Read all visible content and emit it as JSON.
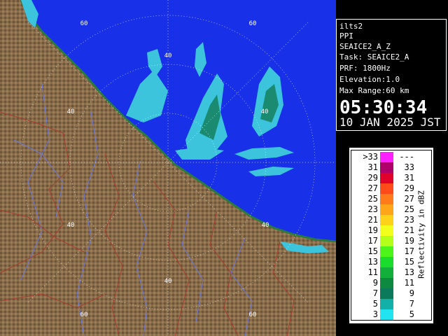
{
  "info": {
    "site": "ilts2",
    "product": "PPI",
    "scan": "SEAICE2_A_Z",
    "task": "Task: SEAICE2_A",
    "prf": "PRF: 1800Hz",
    "elevation": "Elevation:1.0",
    "max_range": "Max Range:60 km",
    "time": "05:30:34",
    "date": "10 JAN 2025 JST"
  },
  "range_labels": {
    "r40_n": "40",
    "r40_e": "40",
    "r40_s": "40",
    "r40_w": "40",
    "r40_se": "40",
    "r60_nw": "60",
    "r60_ne": "60",
    "r60_sw": "60",
    "r60_se": "60"
  },
  "legend": {
    "title": "Reflectivity in dBZ",
    "rows": [
      {
        "lo": ">33",
        "hi": "---",
        "color": "#ff20ff"
      },
      {
        "lo": "31",
        "hi": "33",
        "color": "#b0006a"
      },
      {
        "lo": "29",
        "hi": "31",
        "color": "#e0002a"
      },
      {
        "lo": "27",
        "hi": "29",
        "color": "#ff4a1a"
      },
      {
        "lo": "25",
        "hi": "27",
        "color": "#ff7a1a"
      },
      {
        "lo": "23",
        "hi": "25",
        "color": "#ffa51a"
      },
      {
        "lo": "21",
        "hi": "23",
        "color": "#ffd21a"
      },
      {
        "lo": "19",
        "hi": "21",
        "color": "#f2ff1a"
      },
      {
        "lo": "17",
        "hi": "19",
        "color": "#b4ff1a"
      },
      {
        "lo": "15",
        "hi": "17",
        "color": "#4cf41a"
      },
      {
        "lo": "13",
        "hi": "15",
        "color": "#1adc2c"
      },
      {
        "lo": "11",
        "hi": "13",
        "color": "#12b03a"
      },
      {
        "lo": "9",
        "hi": "11",
        "color": "#0e8a40"
      },
      {
        "lo": "7",
        "hi": "9",
        "color": "#0a7a5a"
      },
      {
        "lo": "5",
        "hi": "7",
        "color": "#12b0a8"
      },
      {
        "lo": "3",
        "hi": "5",
        "color": "#22e4f0"
      }
    ]
  },
  "colors": {
    "sea": "#1830e8",
    "land": "#8a6d48",
    "land_dark": "#5a4530",
    "rivers": "#6c78d8",
    "boundaries": "#a83c2c",
    "echo_light": "#3cc4dc",
    "echo_dark": "#1a7a6a"
  }
}
